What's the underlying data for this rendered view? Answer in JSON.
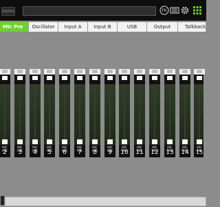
{
  "colors": {
    "accent": "#6ed12e",
    "background": "#8c8c8c",
    "topbar": "#0e0e0e",
    "strip": "#101010"
  },
  "header": {
    "title_value": "",
    "icons": [
      "fader-keep-icon",
      "mackie-logo-icon",
      "gear-icon",
      "mixer-grid-icon"
    ],
    "fk_label": "FK"
  },
  "tabs": [
    {
      "label": "Mic Pre",
      "active": true
    },
    {
      "label": "Oscillator"
    },
    {
      "label": "Input A"
    },
    {
      "label": "Input B"
    },
    {
      "label": "USB"
    },
    {
      "label": "Output"
    },
    {
      "label": "Talkback"
    }
  ],
  "channels": [
    {
      "source": "MIC PRE",
      "number": "2"
    },
    {
      "source": "MIC PRE",
      "number": "3"
    },
    {
      "source": "MIC PRE",
      "number": "4"
    },
    {
      "source": "MIC PRE",
      "number": "5"
    },
    {
      "source": "MIC PRE",
      "number": "6"
    },
    {
      "source": "MIC PRE",
      "number": "7"
    },
    {
      "source": "MIC PRE",
      "number": "8"
    },
    {
      "source": "MIC PRE",
      "number": "9"
    },
    {
      "source": "MIC PRE",
      "number": "10"
    },
    {
      "source": "MIC PRE",
      "number": "11"
    },
    {
      "source": "MIC PRE",
      "number": "12"
    },
    {
      "source": "MIC PRE",
      "number": "13"
    },
    {
      "source": "MIC PRE",
      "number": "14"
    },
    {
      "source": "MIC PRE",
      "number": "15"
    }
  ]
}
